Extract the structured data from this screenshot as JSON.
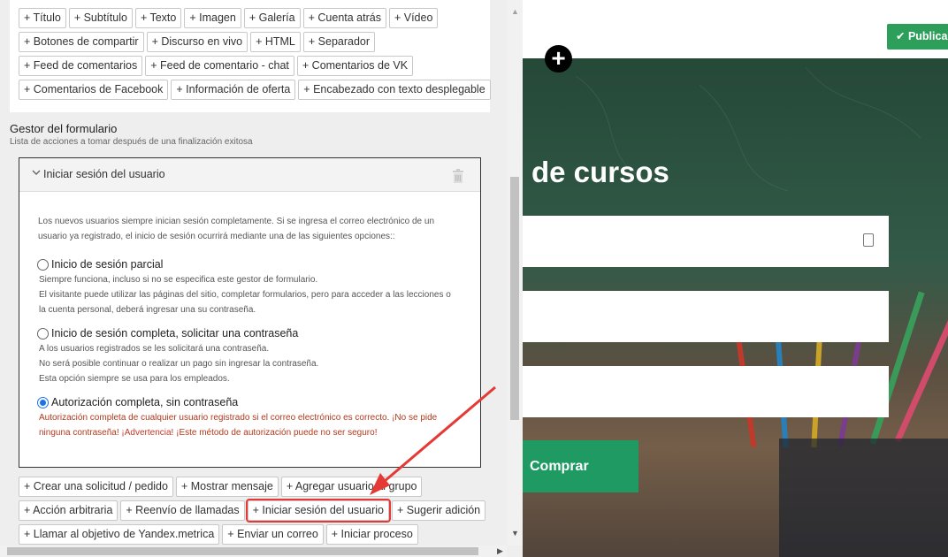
{
  "blocks": {
    "row1": [
      "+ Título",
      "+ Subtítulo",
      "+ Texto",
      "+ Imagen",
      "+ Galería",
      "+ Cuenta atrás",
      "+ Vídeo"
    ],
    "row2": [
      "+ Botones de compartir",
      "+ Discurso en vivo",
      "+ HTML",
      "+ Separador"
    ],
    "row3": [
      "+ Feed de comentarios",
      "+ Feed de comentario - chat",
      "+ Comentarios de VK"
    ],
    "row4": [
      "+ Comentarios de Facebook",
      "+ Información de oferta",
      "+ Encabezado con texto desplegable"
    ]
  },
  "form_manager": {
    "title": "Gestor del formulario",
    "subtitle": "Lista de acciones a tomar después de una finalización exitosa"
  },
  "action": {
    "title": "Iniciar sesión del usuario",
    "intro_1": "Los nuevos usuarios siempre inician sesión completamente. Si se ingresa el correo electrónico de un",
    "intro_2": "usuario ya registrado, el inicio de sesión ocurrirá mediante una de las siguientes opciones::",
    "options": [
      {
        "label": "Inicio de sesión parcial",
        "checked": false,
        "desc": [
          "Siempre funciona, incluso si no se especifica este gestor de formulario.",
          "El visitante puede utilizar las páginas del sitio, completar formularios, pero para acceder a las lecciones o",
          "la cuenta personal, deberá ingresar una su contraseña."
        ]
      },
      {
        "label": "Inicio de sesión completa, solicitar una contraseña",
        "checked": false,
        "desc": [
          "A los usuarios registrados se les solicitará una contraseña.",
          "No será posible continuar o realizar un pago sin ingresar la contraseña.",
          "Esta opción siempre se usa para los empleados."
        ]
      },
      {
        "label": "Autorización completa, sin contraseña",
        "checked": true,
        "desc_1": "Autorización completa de cualquier usuario registrado si el correo electrónico es correcto. ¡No se pide",
        "desc_2a": "ninguna contraseña!",
        "desc_2b": "¡Advertencia!",
        "desc_2c": "¡Este método de autorización puede no ser seguro!"
      }
    ]
  },
  "action_buttons": {
    "row1": [
      "+ Crear una solicitud / pedido",
      "+ Mostrar mensaje",
      "+ Agregar usuario al grupo"
    ],
    "row2": [
      "+ Acción arbitraria",
      "+ Reenvío de llamadas",
      "+ Iniciar sesión del usuario",
      "+ Sugerir adición"
    ],
    "row3": [
      "+ Llamar al objetivo de Yandex.metrica",
      "+ Enviar un correo",
      "+ Iniciar proceso"
    ],
    "highlighted": "+ Iniciar sesión del usuario"
  },
  "preview": {
    "publish_label": "✔ Publicar",
    "hero_title": "de cursos",
    "buy_label": "Comprar",
    "add_block_icon": "plus-icon"
  },
  "colors": {
    "publish": "#2e9e5b",
    "buy": "#1f9a63",
    "highlight": "#e53935",
    "radio_checked": "#1a73e8"
  }
}
